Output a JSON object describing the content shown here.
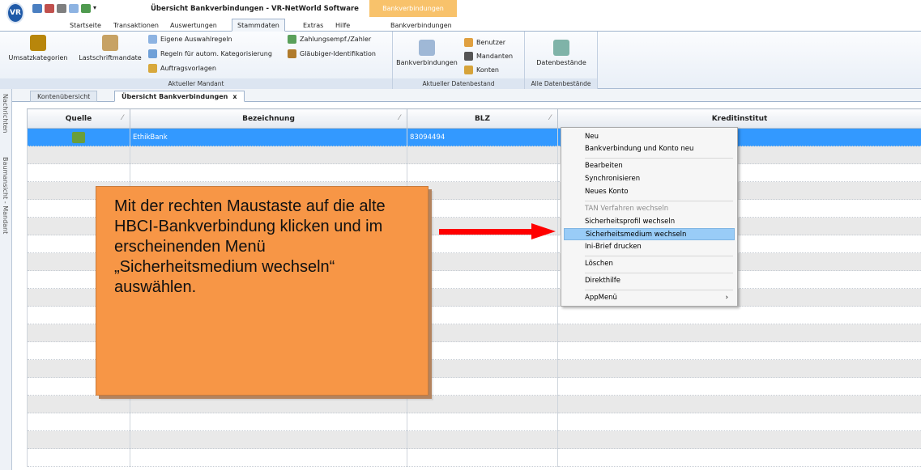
{
  "window": {
    "title": "Übersicht Bankverbindungen - VR-NetWorld Software",
    "context_tab": "Bankverbindungen",
    "logo": "VR"
  },
  "tabs": [
    "Startseite",
    "Transaktionen",
    "Auswertungen",
    "Stammdaten",
    "Extras",
    "Hilfe",
    "Bankverbindungen"
  ],
  "ribbon": {
    "group1": {
      "label": "Aktueller Mandant",
      "big1": "Umsatzkategorien",
      "big2": "Lastschriftmandate",
      "s1": "Eigene Auswahlregeln",
      "s2": "Regeln für autom. Kategorisierung",
      "s3": "Auftragsvorlagen",
      "s4": "Zahlungsempf./Zahler",
      "s5": "Gläubiger-Identifikation"
    },
    "group2": {
      "label": "Aktueller Datenbestand",
      "big1": "Bankverbindungen",
      "s1": "Benutzer",
      "s2": "Mandanten",
      "s3": "Konten"
    },
    "group3": {
      "label": "Alle Datenbestände",
      "big1": "Datenbestände"
    }
  },
  "sidebar": {
    "v1": "Nachrichten",
    "v2": "Baumansicht - Mandant"
  },
  "doc_tabs": {
    "t1": "Kontenübersicht",
    "t2": "Übersicht Bankverbindungen",
    "close": "x"
  },
  "grid": {
    "headers": {
      "c1": "Quelle",
      "c2": "Bezeichnung",
      "c3": "BLZ",
      "c4": "Kreditinstitut"
    },
    "row1": {
      "name": "EthikBank",
      "blz": "83094494"
    }
  },
  "callout": "Mit der rechten Maustaste auf die alte HBCI-Bankverbindung klicken und im erscheinenden Menü „Sicherheitsmedium wechseln“ auswählen.",
  "menu": {
    "i1": "Neu",
    "i2": "Bankverbindung und Konto neu",
    "i3": "Bearbeiten",
    "i4": "Synchronisieren",
    "i5": "Neues Konto",
    "i6": "TAN Verfahren wechseln",
    "i7": "Sicherheitsprofil wechseln",
    "i8": "Sicherheitsmedium wechseln",
    "i9": "Ini-Brief drucken",
    "i10": "Löschen",
    "i11": "Direkthilfe",
    "i12": "AppMenü",
    "submenu_arrow": "›"
  },
  "colors": {
    "selection": "#3399ff",
    "callout": "#f79646",
    "arrow": "#ff0000",
    "menu_highlight": "#99ccf7",
    "context_tab": "#f8c26b"
  }
}
